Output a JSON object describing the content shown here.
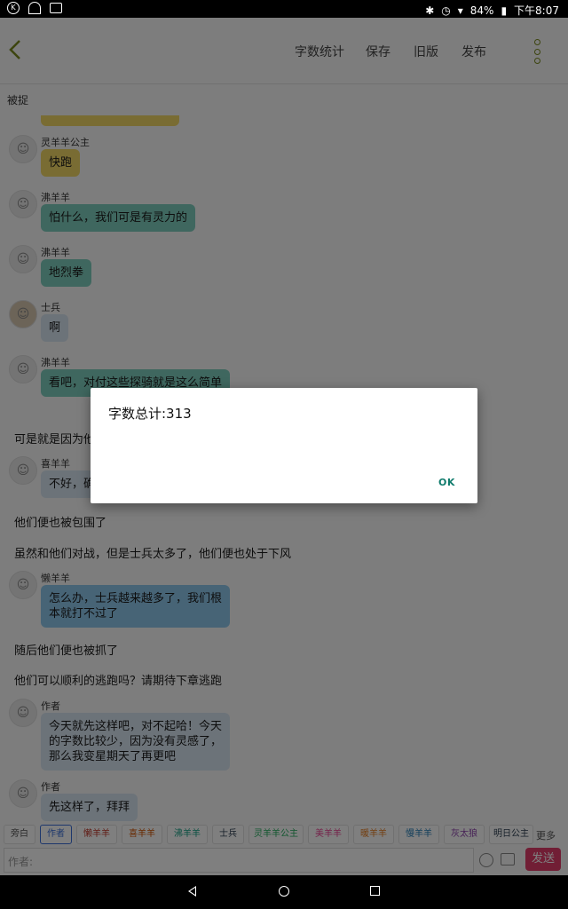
{
  "status_bar": {
    "battery": "84%",
    "time": "下午8:07"
  },
  "toolbar": {
    "buttons": [
      "字数统计",
      "保存",
      "旧版",
      "发布"
    ]
  },
  "chapter_title": "被捉",
  "chat": {
    "messages": [
      {
        "type": "msg",
        "name": "灵羊羊公主",
        "text": "快跑",
        "avatar": "goat-avatar",
        "color": "#f2d867"
      },
      {
        "type": "msg",
        "name": "沸羊羊",
        "text": "怕什么，我们可是有灵力的",
        "avatar": "goat-avatar",
        "color": "#7fcfbe"
      },
      {
        "type": "msg",
        "name": "沸羊羊",
        "text": "地烈拳",
        "avatar": "goat-avatar",
        "color": "#7fcfbe"
      },
      {
        "type": "msg",
        "name": "士兵",
        "text": "啊",
        "avatar": "soldier-avatar",
        "color": "#d9e7f3"
      },
      {
        "type": "msg",
        "name": "沸羊羊",
        "text": "看吧，对付这些探骑就是这么简单",
        "avatar": "goat-avatar",
        "color": "#7fcfbe"
      },
      {
        "type": "narr",
        "text": "可是就是因为他们"
      },
      {
        "type": "msg",
        "name": "喜羊羊",
        "text": "不好，确",
        "avatar": "goat-avatar",
        "color": "#d9e7f3"
      },
      {
        "type": "narr",
        "text": "他们便也被包围了"
      },
      {
        "type": "narr",
        "text": "虽然和他们对战，但是士兵太多了，他们便也处于下风"
      },
      {
        "type": "msg",
        "name": "懒羊羊",
        "text": "怎么办，士兵越来越多了，我们根\n本就打不过了",
        "avatar": "goat-avatar",
        "color": "#8fc8ec"
      },
      {
        "type": "narr",
        "text": "随后他们便也被抓了"
      },
      {
        "type": "narr",
        "text": "他们可以顺利的逃跑吗？请期待下章逃跑"
      },
      {
        "type": "msg",
        "name": "作者",
        "text": "今天就先这样吧，对不起哈！今天\n的字数比较少，因为没有灵感了，\n那么我变星期天了再更吧",
        "avatar": "goat-avatar",
        "color": "#d9e7f3"
      },
      {
        "type": "msg",
        "name": "作者",
        "text": "先这样了，拜拜",
        "avatar": "goat-avatar",
        "color": "#d9e7f3"
      }
    ]
  },
  "roles": [
    {
      "label": "旁白",
      "color": "#555555"
    },
    {
      "label": "作者",
      "color": "#3a6fd8"
    },
    {
      "label": "懒羊羊",
      "color": "#c0392b"
    },
    {
      "label": "喜羊羊",
      "color": "#d35400"
    },
    {
      "label": "沸羊羊",
      "color": "#16a085"
    },
    {
      "label": "士兵",
      "color": "#2c3e50"
    },
    {
      "label": "灵羊羊公主",
      "color": "#27ae60"
    },
    {
      "label": "美羊羊",
      "color": "#e84393"
    },
    {
      "label": "暖羊羊",
      "color": "#e67e22"
    },
    {
      "label": "慢羊羊",
      "color": "#2980b9"
    },
    {
      "label": "灰太狼",
      "color": "#8e44ad"
    },
    {
      "label": "明日公主",
      "color": "#2c3e50"
    }
  ],
  "more_label": "更多",
  "input_placeholder": "作者:",
  "send_label": "发送",
  "dialog": {
    "message": "字数总计:313",
    "ok_label": "OK"
  }
}
